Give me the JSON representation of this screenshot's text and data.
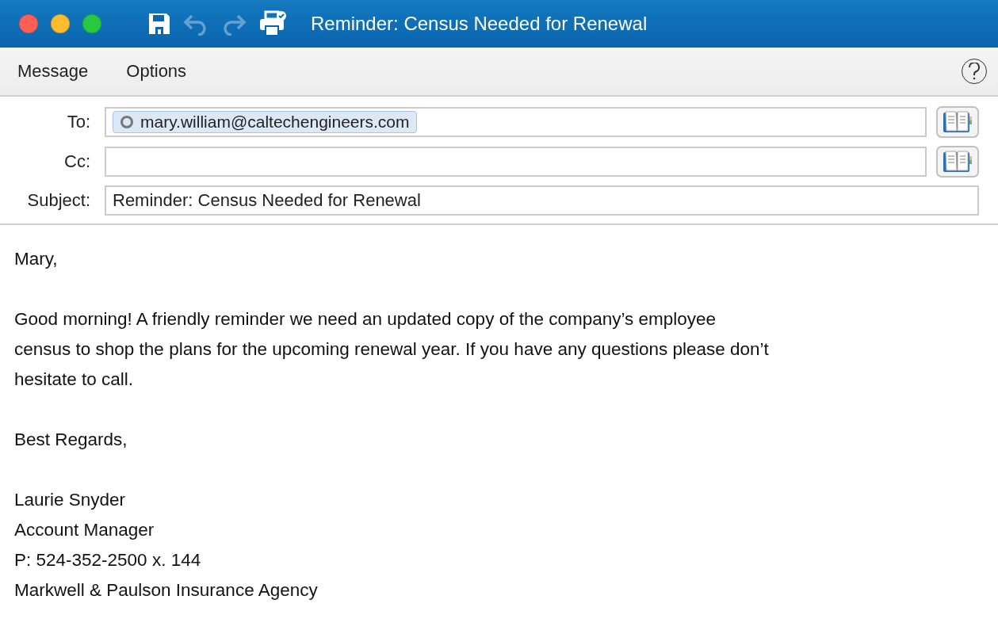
{
  "window": {
    "title": "Reminder: Census Needed for Renewal"
  },
  "title_toolbar": [
    {
      "kind": "save",
      "disabled": false
    },
    {
      "kind": "undo",
      "disabled": true
    },
    {
      "kind": "redo",
      "disabled": true
    },
    {
      "kind": "print",
      "disabled": false
    }
  ],
  "ribbon_tabs": [
    "Message",
    "Options"
  ],
  "header": {
    "to": {
      "label": "To:",
      "recipients": [
        "mary.william@caltechengineers.com"
      ]
    },
    "cc": {
      "label": "Cc:"
    },
    "subject": {
      "label": "Subject:",
      "value": "Reminder: Census Needed for Renewal"
    }
  },
  "body": [
    [
      "Mary,"
    ],
    [
      "Good morning! A friendly reminder we need an updated copy of the company’s employee census to shop the plans for the upcoming renewal year. If you have any questions please don’t hesitate to call."
    ],
    [
      "Best Regards,"
    ],
    [
      "Laurie Snyder",
      "Account Manager",
      "P: 524-352-2500 x. 144",
      "Markwell & Paulson Insurance Agency"
    ]
  ]
}
